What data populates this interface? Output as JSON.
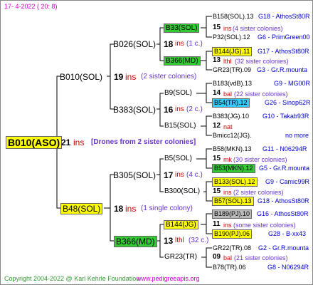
{
  "header": {
    "date": "17-  4-2022 ( 20:  8)"
  },
  "footer": {
    "copyright": "Copyright 2004-2022 @ Karl Kehrle Foundation",
    "site": "www.pedigreeapis.org"
  },
  "root": {
    "name": "B010(ASO)",
    "ins_count": "21",
    "ins_label": "ins",
    "note": "[Drones from 2 sister colonies]"
  },
  "gen1": [
    {
      "name": "B010(SOL)",
      "ins_count": "19",
      "ins_label": "ins",
      "note": "(2 sister colonies)"
    },
    {
      "name": "B48(SOL)",
      "ins_count": "18",
      "ins_label": "ins",
      "note": "(1 single colony)"
    }
  ],
  "gen2": [
    {
      "name": "B026(SOL)",
      "ins_count": "18",
      "ins_label": "ins",
      "note": "(1 c.)"
    },
    {
      "name": "B383(SOL)",
      "ins_count": "16",
      "ins_label": "ins",
      "note": "(2 c.)"
    },
    {
      "name": "B305(SOL)",
      "ins_count": "17",
      "ins_label": "ins",
      "note": "(4 c.)"
    },
    {
      "name": "B366(MD)",
      "ins_count": "13",
      "ins_label": "lthl",
      "note": "(32 c.)"
    }
  ],
  "gen3": [
    {
      "name": "B33(SOL)"
    },
    {
      "name": "B366(MD)"
    },
    {
      "name": "B9(SOL)"
    },
    {
      "name": "B15(SOL)"
    },
    {
      "name": "B5(SOL)"
    },
    {
      "name": "B300(SOL)"
    },
    {
      "name": "B144(JG)"
    },
    {
      "name": "GR23(TR)"
    }
  ],
  "gen4": [
    {
      "name": "B158(SOL).13",
      "right": "G18 - AthosSt80R"
    },
    {
      "count": "15",
      "label": "ins",
      "note": "(4 sister colonies)"
    },
    {
      "name": "P32(SOL).12",
      "right": "G6 - PrimGreen00"
    },
    {
      "name": "B144(JG).11",
      "right": "G17 - AthosSt80R"
    },
    {
      "count": "13",
      "label": "lthl",
      "note": "(32 sister colonies)"
    },
    {
      "name": "GR23(TR).09",
      "right": "G3 - Gr.R.mounta"
    },
    {
      "name": "B183(vdB).13",
      "right": "G9 - MG00R"
    },
    {
      "count": "14",
      "label": "bal",
      "note": "(22 sister colonies)"
    },
    {
      "name": "B54(TR).12",
      "right": "G26 - Sinop62R"
    },
    {
      "name": "B383(JG).10",
      "right": "G10 - Takab93R"
    },
    {
      "count": "12",
      "label": "nat",
      "note": ""
    },
    {
      "name": "Bmicc12(JG).",
      "right": "no more"
    },
    {
      "name": "B58(MKN).13",
      "right": "G11 - N06294R"
    },
    {
      "count": "15",
      "label": "mk",
      "note": "(30 sister colonies)"
    },
    {
      "name": "B53(MKN).12",
      "right": "G5 - Gr.R.mounta"
    },
    {
      "name": "B133(SOL).12",
      "right": "G9 - Camic99R"
    },
    {
      "count": "15",
      "label": "ins",
      "note": "(2 sister colonies)"
    },
    {
      "name": "B57(SOL).13",
      "right": "G18 - AthosSt80R"
    },
    {
      "name": "B189(PJ).10",
      "right": "G16 - AthosSt80R"
    },
    {
      "count": "11",
      "label": "ins",
      "note": "(some sister colonies)"
    },
    {
      "name": "B190(PJ).06",
      "right": "G28 - B-xx43"
    },
    {
      "name": "GR22(TR).08",
      "right": "G2 - Gr.R.mounta"
    },
    {
      "count": "09",
      "label": "bal",
      "note": "(21 sister colonies)"
    },
    {
      "name": "B78(TR).06",
      "right": "G8 - N06294R"
    }
  ],
  "colors": {
    "yellow": "#ffff00",
    "green": "#33cc33",
    "cyan": "#33ccff",
    "grey": "#bbbbbb",
    "ins": "#cc0000",
    "note": "#6633cc"
  }
}
